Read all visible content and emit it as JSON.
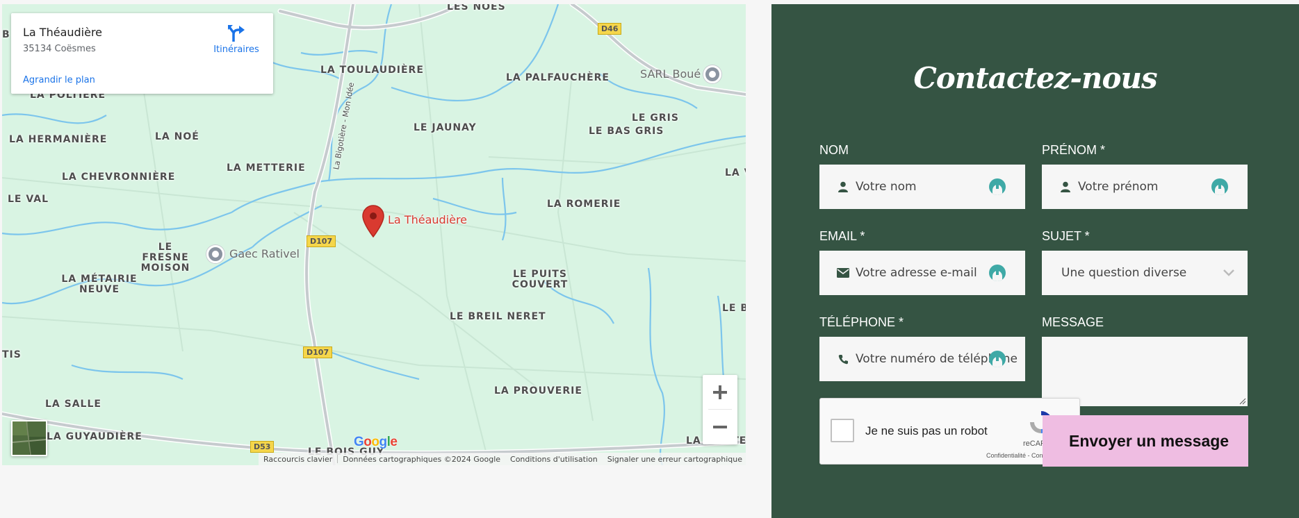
{
  "map": {
    "place_card": {
      "title": "La Théaudière",
      "address": "35134 Coësmes",
      "enlarge_link": "Agrandir le plan",
      "directions_label": "Itinéraires",
      "directions_icon": "directions-icon"
    },
    "marker": {
      "label": "La Théaudière",
      "color": "#d93a30"
    },
    "place_names": [
      "LES NOES",
      "LA TOULAUDIÈRE",
      "LA PALFAUCHÈRE",
      "LA POLTIÈRE",
      "LE GRIS",
      "LE BAS GRIS",
      "LE JAUNAY",
      "LA HERMANIÈRE",
      "LA NOÉ",
      "LA CHEVRONNIÈRE",
      "LA METTERIE",
      "LE VAL",
      "LA ROMERIE",
      "LE FRESNE MOISON",
      "LA MÉTAIRIE NEUVE",
      "LE PUITS COUVERT",
      "LE BREIL NERET",
      "LA PROUVERIE",
      "LA SALLE",
      "LA GUYAUDIÈRE",
      "LE BOIS GUY",
      "LA PETITE CALANDIÈRE",
      "LA V",
      "LE B",
      "TIS",
      "B"
    ],
    "road_name": "La Bigotière - Mon Idée",
    "poi": [
      {
        "label": "SARL Boué"
      },
      {
        "label": "Gaec Rativel"
      }
    ],
    "road_shields": [
      "D46",
      "D107",
      "D107",
      "D53"
    ],
    "zoom_in_symbol": "+",
    "zoom_out_symbol": "−",
    "google_logo": "Google",
    "attribution": {
      "shortcuts": "Raccourcis clavier",
      "data": "Données cartographiques ©2024 Google",
      "terms": "Conditions d'utilisation",
      "report": "Signaler une erreur cartographique"
    },
    "colors": {
      "land": "#d9f4e3",
      "water": "#7cc5ec",
      "road": "#c6cbce"
    }
  },
  "contact": {
    "title": "Contactez-nous",
    "background": "#355443",
    "fields": {
      "nom": {
        "label": "NOM",
        "placeholder": "Votre nom",
        "icon": "user-icon"
      },
      "prenom": {
        "label": "PRÉNOM *",
        "placeholder": "Votre prénom",
        "icon": "user-icon"
      },
      "email": {
        "label": "EMAIL *",
        "placeholder": "Votre adresse e-mail",
        "icon": "envelope-icon"
      },
      "sujet": {
        "label": "SUJET *",
        "selected": "Une question diverse",
        "icon": "chevron-down-icon"
      },
      "telephone": {
        "label": "TÉLÉPHONE *",
        "placeholder": "Votre numéro de téléphone",
        "icon": "phone-icon"
      },
      "message": {
        "label": "MESSAGE"
      }
    },
    "captcha": {
      "label": "Je ne suis pas un robot",
      "brand": "reCAPTCHA",
      "links": "Confidentialité - Conditions"
    },
    "submit_label": "Envoyer un message",
    "accent": "#3fa9a6",
    "button_color": "#efbde2"
  }
}
